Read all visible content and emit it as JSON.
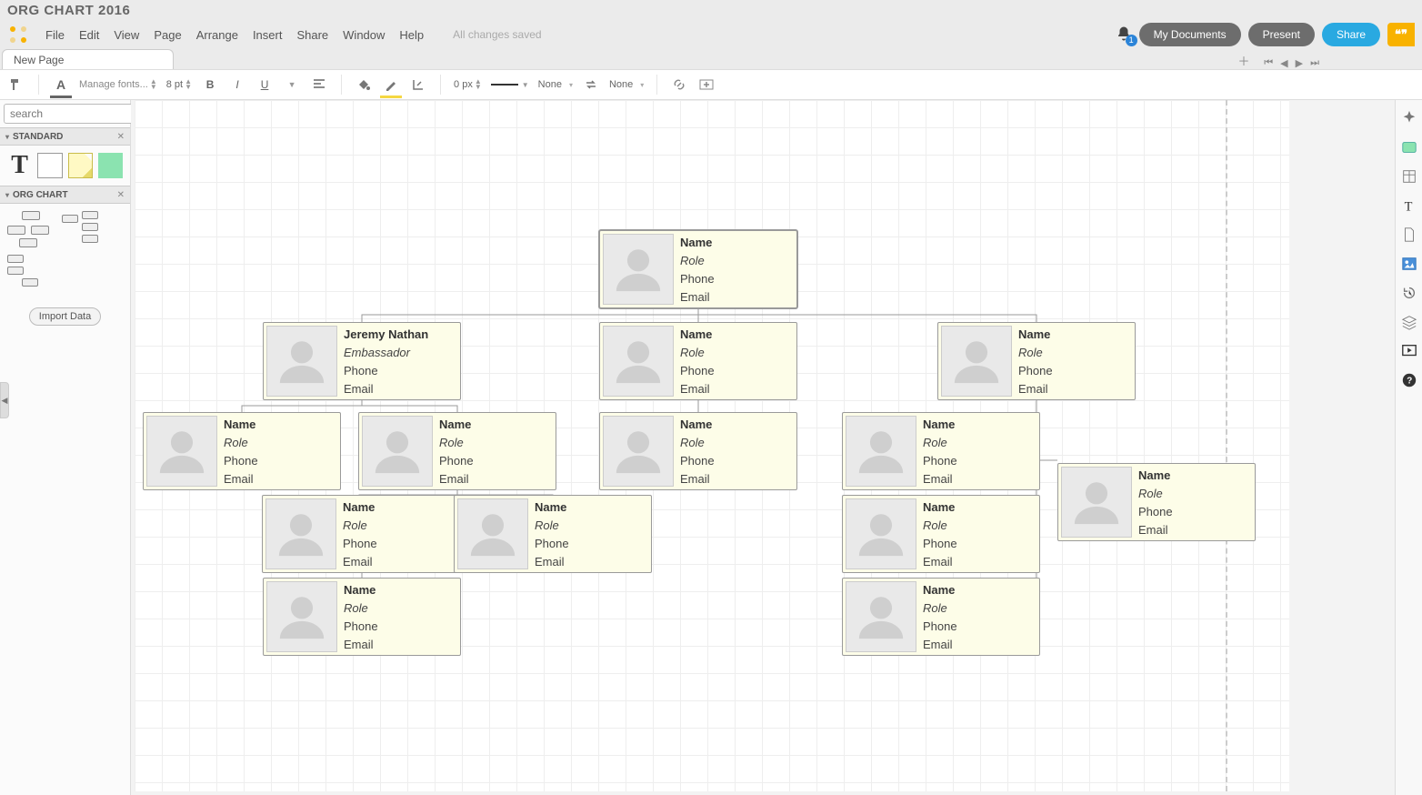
{
  "document_title": "ORG CHART 2016",
  "menu": [
    "File",
    "Edit",
    "View",
    "Page",
    "Arrange",
    "Insert",
    "Share",
    "Window",
    "Help"
  ],
  "save_status": "All changes saved",
  "notifications_count": "1",
  "buttons": {
    "my_documents": "My Documents",
    "present": "Present",
    "share": "Share"
  },
  "tabs": [
    {
      "label": "New Page"
    }
  ],
  "toolbar": {
    "font_manage": "Manage fonts...",
    "font_size": "8 pt",
    "line_px": "0 px",
    "arrow_left": "None",
    "arrow_right": "None"
  },
  "sidebar": {
    "search_placeholder": "search",
    "panels": [
      {
        "title": "STANDARD"
      },
      {
        "title": "ORG CHART"
      }
    ],
    "import_label": "Import Data"
  },
  "defaults": {
    "name": "Name",
    "role": "Role",
    "phone": "Phone",
    "email": "Email"
  },
  "cards": {
    "root": {
      "name": "Name",
      "role": "Role",
      "phone": "Phone",
      "email": "Email"
    },
    "a": {
      "name": "Jeremy Nathan",
      "role": "Embassador",
      "phone": "Phone",
      "email": "Email"
    },
    "b": {
      "name": "Name",
      "role": "Role",
      "phone": "Phone",
      "email": "Email"
    },
    "c": {
      "name": "Name",
      "role": "Role",
      "phone": "Phone",
      "email": "Email"
    },
    "a1": {
      "name": "Name",
      "role": "Role",
      "phone": "Phone",
      "email": "Email"
    },
    "a2": {
      "name": "Name",
      "role": "Role",
      "phone": "Phone",
      "email": "Email"
    },
    "b1": {
      "name": "Name",
      "role": "Role",
      "phone": "Phone",
      "email": "Email"
    },
    "c1": {
      "name": "Name",
      "role": "Role",
      "phone": "Phone",
      "email": "Email"
    },
    "a2a": {
      "name": "Name",
      "role": "Role",
      "phone": "Phone",
      "email": "Email"
    },
    "a2b": {
      "name": "Name",
      "role": "Role",
      "phone": "Phone",
      "email": "Email"
    },
    "c2": {
      "name": "Name",
      "role": "Role",
      "phone": "Phone",
      "email": "Email"
    },
    "c3": {
      "name": "Name",
      "role": "Role",
      "phone": "Phone",
      "email": "Email"
    },
    "c4": {
      "name": "Name",
      "role": "Role",
      "phone": "Phone",
      "email": "Email"
    },
    "a3": {
      "name": "Name",
      "role": "Role",
      "phone": "Phone",
      "email": "Email"
    }
  }
}
